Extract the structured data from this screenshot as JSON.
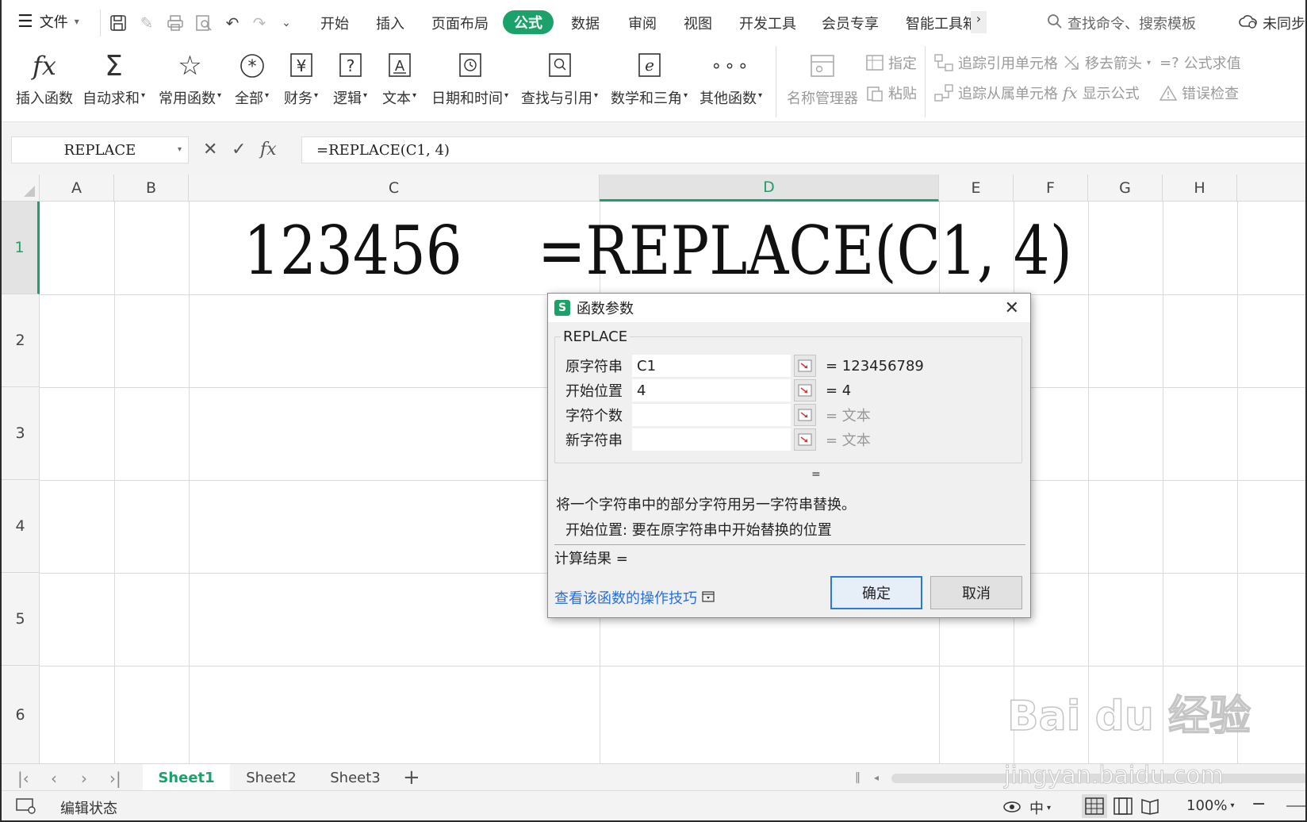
{
  "menu": {
    "file": "文件",
    "tabs": [
      "开始",
      "插入",
      "页面布局",
      "公式",
      "数据",
      "审阅",
      "视图",
      "开发工具",
      "会员专享",
      "智能工具箱"
    ],
    "active_tab": "公式",
    "search": "查找命令、搜索模板",
    "sync": "未同步"
  },
  "ribbon": {
    "buttons": [
      {
        "label": "插入函数",
        "icon": "fx-icon"
      },
      {
        "label": "自动求和",
        "icon": "sigma-icon"
      },
      {
        "label": "常用函数",
        "icon": "star-icon"
      },
      {
        "label": "全部",
        "icon": "asterisk-icon"
      },
      {
        "label": "财务",
        "icon": "yen-icon"
      },
      {
        "label": "逻辑",
        "icon": "question-icon"
      },
      {
        "label": "文本",
        "icon": "text-a-icon"
      },
      {
        "label": "日期和时间",
        "icon": "clock-icon"
      },
      {
        "label": "查找与引用",
        "icon": "magnifier-icon"
      },
      {
        "label": "数学和三角",
        "icon": "e-icon"
      },
      {
        "label": "其他函数",
        "icon": "more-icon"
      },
      {
        "label": "名称管理器",
        "icon": "name-manager-icon"
      }
    ],
    "small": [
      "指定",
      "粘贴",
      "追踪引用单元格",
      "追踪从属单元格",
      "移去箭头",
      "显示公式",
      "公式求值",
      "错误检查"
    ]
  },
  "formula_bar": {
    "name_box": "REPLACE",
    "formula": "=REPLACE(C1, 4)"
  },
  "grid": {
    "columns": [
      "A",
      "B",
      "C",
      "D",
      "E",
      "F",
      "G",
      "H"
    ],
    "rows": [
      "1",
      "2",
      "3",
      "4",
      "5",
      "6"
    ],
    "selected_column": "D",
    "selected_row": "1",
    "c1": "123456",
    "d1": "=REPLACE(C1, 4)"
  },
  "dialog": {
    "title": "函数参数",
    "function_name": "REPLACE",
    "args": [
      {
        "name": "原字符串",
        "value": "C1",
        "result": "= 123456789"
      },
      {
        "name": "开始位置",
        "value": "4",
        "result": "= 4"
      },
      {
        "name": "字符个数",
        "value": "",
        "result": "= 文本"
      },
      {
        "name": "新字符串",
        "value": "",
        "result": "= 文本"
      }
    ],
    "result_eq": "=",
    "description": "将一个字符串中的部分字符用另一字符串替换。",
    "arg_help": "开始位置:  要在原字符串中开始替换的位置",
    "calc_result": "计算结果 =",
    "help_link": "查看该函数的操作技巧",
    "ok": "确定",
    "cancel": "取消"
  },
  "sheets": {
    "tabs": [
      "Sheet1",
      "Sheet2",
      "Sheet3"
    ],
    "active": "Sheet1"
  },
  "status": {
    "mode": "编辑状态",
    "zoom": "100%"
  },
  "watermark": {
    "line1": "Bai du 经验",
    "line2": "jingyan.baidu.com"
  },
  "colors": {
    "accent": "#1aa26a",
    "link": "#2a6fd6"
  }
}
